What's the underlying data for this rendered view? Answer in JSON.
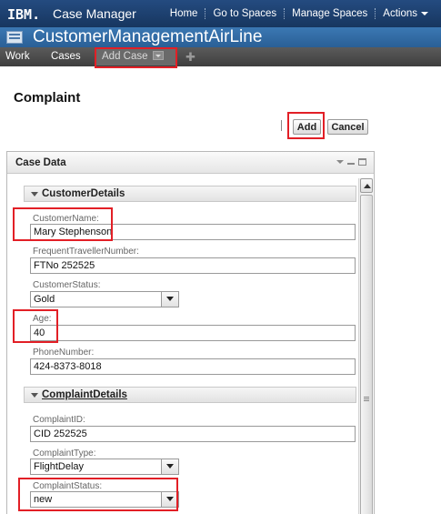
{
  "topbar": {
    "logo": "IBM.",
    "product": "Case Manager",
    "nav": [
      "Home",
      "Go to Spaces",
      "Manage Spaces",
      "Actions"
    ]
  },
  "solution": {
    "title": "CustomerManagementAirLine"
  },
  "tabs": {
    "work": "Work",
    "cases": "Cases",
    "add_case": "Add Case"
  },
  "page": {
    "title": "Complaint",
    "add_label": "Add",
    "cancel_label": "Cancel"
  },
  "panel": {
    "title": "Case Data"
  },
  "customer_details": {
    "title": "CustomerDetails",
    "fields": {
      "name_label": "CustomerName:",
      "name_value": "Mary Stephenson",
      "ftn_label": "FrequentTravellerNumber:",
      "ftn_value": "FTNo 252525",
      "status_label": "CustomerStatus:",
      "status_value": "Gold",
      "age_label": "Age:",
      "age_value": "40",
      "phone_label": "PhoneNumber:",
      "phone_value": "424-8373-8018"
    }
  },
  "complaint_details": {
    "title": "ComplaintDetails",
    "fields": {
      "id_label": "ComplaintID:",
      "id_value": "CID 252525",
      "type_label": "ComplaintType:",
      "type_value": "FlightDelay",
      "status_label": "ComplaintStatus:",
      "status_value": "new"
    }
  },
  "colors": {
    "highlight": "#e21f26",
    "banner": "#1d3f6e",
    "solution_bar": "#3370ab",
    "tab_bar": "#4a4a4a"
  }
}
